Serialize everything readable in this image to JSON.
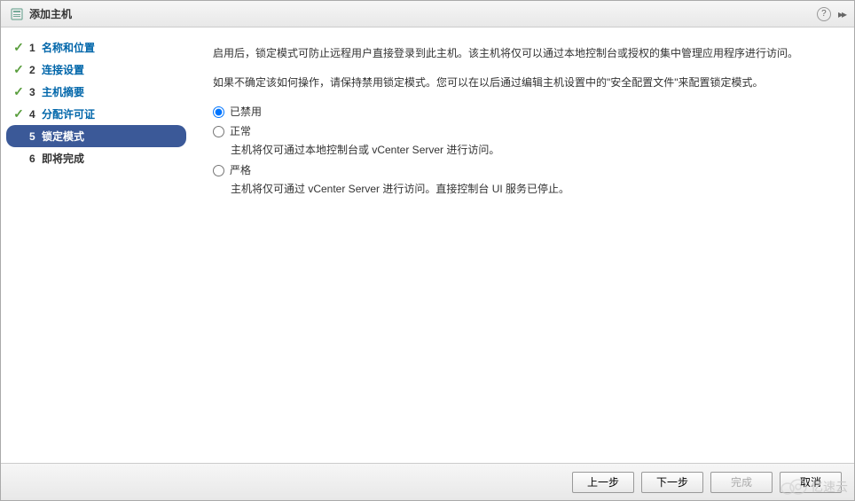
{
  "title": "添加主机",
  "steps": [
    {
      "num": "1",
      "label": "名称和位置",
      "done": true
    },
    {
      "num": "2",
      "label": "连接设置",
      "done": true
    },
    {
      "num": "3",
      "label": "主机摘要",
      "done": true
    },
    {
      "num": "4",
      "label": "分配许可证",
      "done": true
    },
    {
      "num": "5",
      "label": "锁定模式",
      "active": true
    },
    {
      "num": "6",
      "label": "即将完成",
      "pending": true
    }
  ],
  "content": {
    "intro1": "启用后，锁定模式可防止远程用户直接登录到此主机。该主机将仅可以通过本地控制台或授权的集中管理应用程序进行访问。",
    "intro2": "如果不确定该如何操作，请保持禁用锁定模式。您可以在以后通过编辑主机设置中的\"安全配置文件\"来配置锁定模式。"
  },
  "options": {
    "disabled": {
      "label": "已禁用"
    },
    "normal": {
      "label": "正常",
      "desc": "主机将仅可通过本地控制台或 vCenter Server 进行访问。"
    },
    "strict": {
      "label": "严格",
      "desc": "主机将仅可通过 vCenter Server 进行访问。直接控制台 UI 服务已停止。"
    }
  },
  "buttons": {
    "back": "上一步",
    "next": "下一步",
    "finish": "完成",
    "cancel": "取消"
  },
  "watermark": "亿速云"
}
